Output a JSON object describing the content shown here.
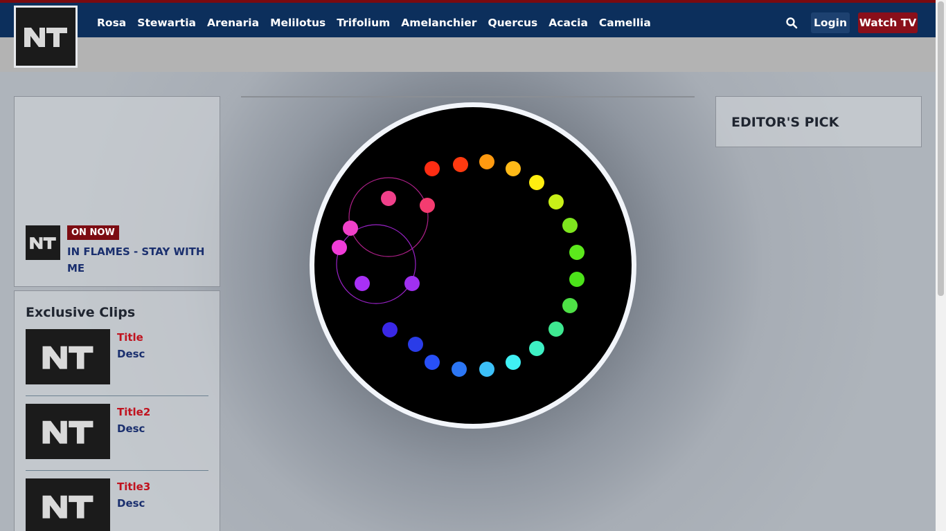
{
  "header": {
    "logo_text": "NT",
    "nav_items": [
      "Rosa",
      "Stewartia",
      "Arenaria",
      "Melilotus",
      "Trifolium",
      "Amelanchier",
      "Quercus",
      "Acacia",
      "Camellia"
    ],
    "search_icon": "search-icon",
    "login_label": "Login",
    "watch_label": "Watch TV",
    "colors": {
      "bar": "#0c2f5c",
      "accent": "#7a0a0f",
      "watch": "#8a0f1a"
    }
  },
  "now_playing": {
    "badge": "ON NOW",
    "title": "IN FLAMES - STAY WITH ME"
  },
  "clips": {
    "heading": "Exclusive Clips",
    "items": [
      {
        "title": "Title",
        "desc": "Desc"
      },
      {
        "title": "Title2",
        "desc": "Desc"
      },
      {
        "title": "Title3",
        "desc": "Desc"
      }
    ]
  },
  "editor": {
    "title": "EDITOR'S PICK"
  },
  "loader": {
    "dot_colors": [
      "#ff2d13",
      "#ff3a10",
      "#ff9a10",
      "#ffba18",
      "#ffee10",
      "#c8f018",
      "#7ee61e",
      "#5ce81c",
      "#4ce21a",
      "#4ee046",
      "#3ee891",
      "#3ef0c4",
      "#40f0f4",
      "#3cc0f8",
      "#2c76f4",
      "#2850f8",
      "#2a3ce8",
      "#3a28e6",
      "#a830f6",
      "#a030f0",
      "#f03cd8",
      "#f040c8",
      "#f0408a",
      "#f43c70"
    ]
  }
}
